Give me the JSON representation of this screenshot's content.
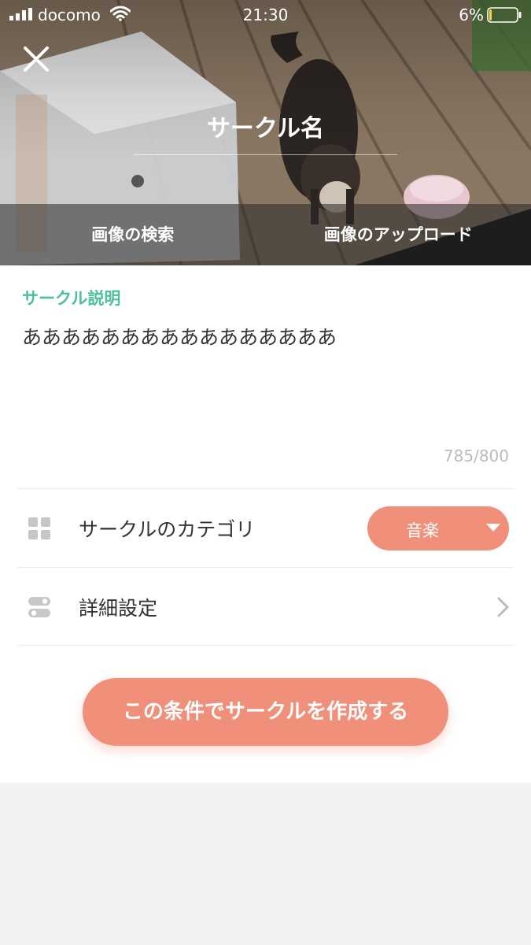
{
  "status_bar": {
    "carrier": "docomo",
    "time": "21:30",
    "battery_percent": "6%",
    "battery_level": 0.06,
    "battery_color": "#f5d547"
  },
  "hero": {
    "circle_name": "サークル名",
    "actions": {
      "search_image": "画像の検索",
      "upload_image": "画像のアップロード"
    }
  },
  "description": {
    "label": "サークル説明",
    "text": "ああああああああああああああああ",
    "char_count": "785/800"
  },
  "category": {
    "label": "サークルのカテゴリ",
    "selected": "音楽"
  },
  "details": {
    "label": "詳細設定"
  },
  "create_button": {
    "label": "この条件でサークルを作成する"
  },
  "colors": {
    "accent": "#f0907a",
    "label_green": "#4dbf9b"
  }
}
